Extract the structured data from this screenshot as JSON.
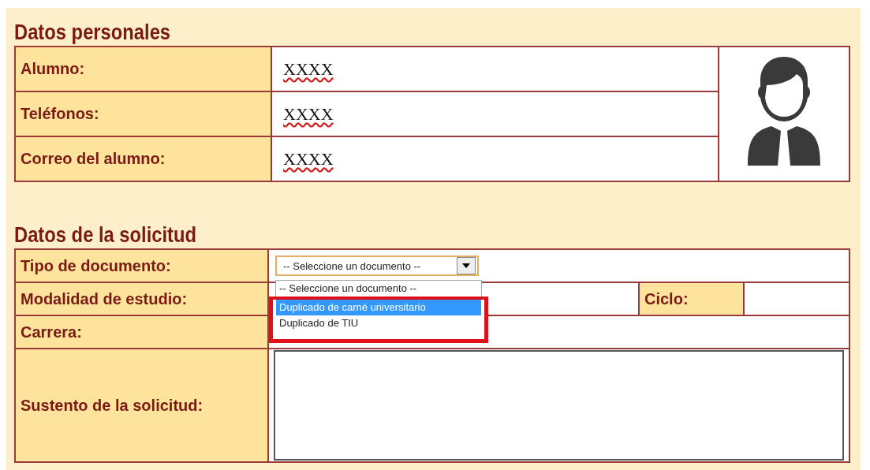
{
  "personal": {
    "title": "Datos personales",
    "fields": [
      {
        "label": "Alumno:",
        "value": "XXXX"
      },
      {
        "label": "Teléfonos:",
        "value": "XXXX"
      },
      {
        "label": "Correo del alumno:",
        "value": "XXXX"
      }
    ]
  },
  "request": {
    "title": "Datos de la solicitud",
    "document": {
      "label": "Tipo de documento:",
      "value": "-- Seleccione un documento --",
      "open": true,
      "options": [
        {
          "label": "-- Seleccione un documento --",
          "highlighted": false
        },
        {
          "label": "Duplicado de carné universitario",
          "highlighted": true
        },
        {
          "label": "Duplicado de TIU",
          "highlighted": false
        }
      ]
    },
    "modality": {
      "label": "Modalidad de estudio:"
    },
    "cycle": {
      "label": "Ciclo:"
    },
    "career": {
      "label": "Carrera:"
    },
    "reason": {
      "label": "Sustento de la solicitud:"
    }
  }
}
